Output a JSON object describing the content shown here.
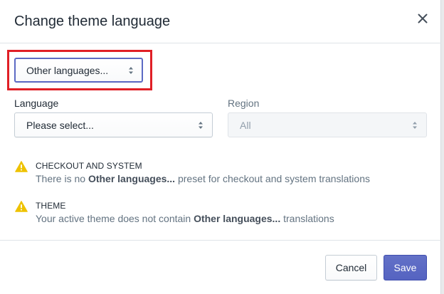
{
  "dialog": {
    "title": "Change theme language",
    "close_icon": "close-icon"
  },
  "preset_select": {
    "value": "Other languages..."
  },
  "language": {
    "label": "Language",
    "value": "Please select..."
  },
  "region": {
    "label": "Region",
    "value": "All",
    "disabled": true
  },
  "notices": [
    {
      "icon": "warning-icon",
      "title": "CHECKOUT AND SYSTEM",
      "text_before": "There is no ",
      "text_bold": "Other languages...",
      "text_after": " preset for checkout and system translations"
    },
    {
      "icon": "warning-icon",
      "title": "THEME",
      "text_before": "Your active theme does not contain ",
      "text_bold": "Other languages...",
      "text_after": " translations"
    }
  ],
  "footer": {
    "cancel_label": "Cancel",
    "save_label": "Save"
  },
  "colors": {
    "accent": "#5c6ac4",
    "warning": "#eec200",
    "highlight": "#e01f26"
  }
}
